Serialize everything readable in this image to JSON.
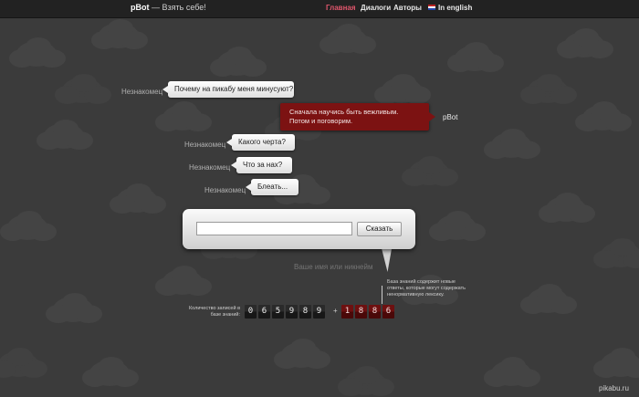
{
  "header": {
    "logo_name": "pBot",
    "logo_tagline": " — Взять себе!",
    "nav": {
      "home": "Главная",
      "dialogs": "Диалоги",
      "authors": "Авторы",
      "english": "In english"
    }
  },
  "chat": {
    "stranger_label": "Незнакомец",
    "bot_label": "pBot",
    "messages": [
      "Почему на пикабу меня минусуют?",
      "Сначала научись быть вежливым. Потом и поговорим.",
      "Какого черта?",
      "Что за нах?",
      "Блеать..."
    ]
  },
  "form": {
    "message_value": "",
    "say_button": "Сказать",
    "name_placeholder": "Ваше имя или никнейм"
  },
  "stats": {
    "label": "Количество записей в базе знаний:",
    "records_digits": [
      "0",
      "6",
      "5",
      "9",
      "8",
      "9"
    ],
    "plus": "+",
    "new_digits": [
      "1",
      "8",
      "8",
      "6"
    ],
    "note": "База знаний содержит новые ответы, которые могут содержать ненормативную лексику."
  },
  "watermark": "pikabu.ru",
  "colors": {
    "background": "#3b3b3b",
    "topbar": "#222222",
    "accent_nav": "#e0566c",
    "bot_bubble": "#7c1212",
    "new_digits": "#6e1010"
  }
}
